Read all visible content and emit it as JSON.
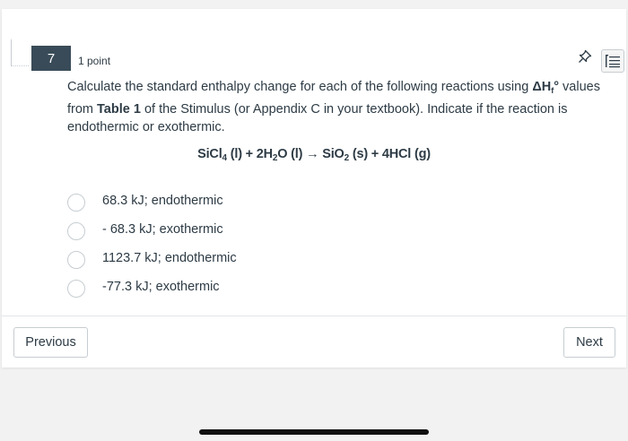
{
  "question": {
    "number": "7",
    "points": "1 point",
    "text_parts": {
      "p1": "Calculate the standard enthalpy change for each of the following reactions using ",
      "dh": "ΔH",
      "dh_sub": "f",
      "dh_sup": "°",
      "p2": " values from ",
      "table": "Table 1",
      "p3": " of the Stimulus (or Appendix C in your textbook). Indicate if the reaction is endothermic or exothermic."
    },
    "equation": {
      "t1": "SiCl",
      "s1": "4",
      "t2": " (l) + 2H",
      "s2": "2",
      "t3": "O (l) ",
      "arrow": "→",
      "t4": " SiO",
      "s4": "2",
      "t5": " (s) + 4HCl (g)"
    },
    "options": [
      {
        "label": "68.3 kJ; endothermic",
        "selected": false
      },
      {
        "label": "- 68.3 kJ; exothermic",
        "selected": false
      },
      {
        "label": "1123.7 kJ; endothermic",
        "selected": false
      },
      {
        "label": "-77.3 kJ; exothermic",
        "selected": false
      }
    ]
  },
  "navigation": {
    "previous_label": "Previous",
    "next_label": "Next"
  },
  "icons": {
    "pin": "pin-icon",
    "list": "question-list-icon"
  },
  "colors": {
    "question_badge": "#394b58",
    "text": "#2d3b45",
    "border": "#c7cdd1"
  }
}
